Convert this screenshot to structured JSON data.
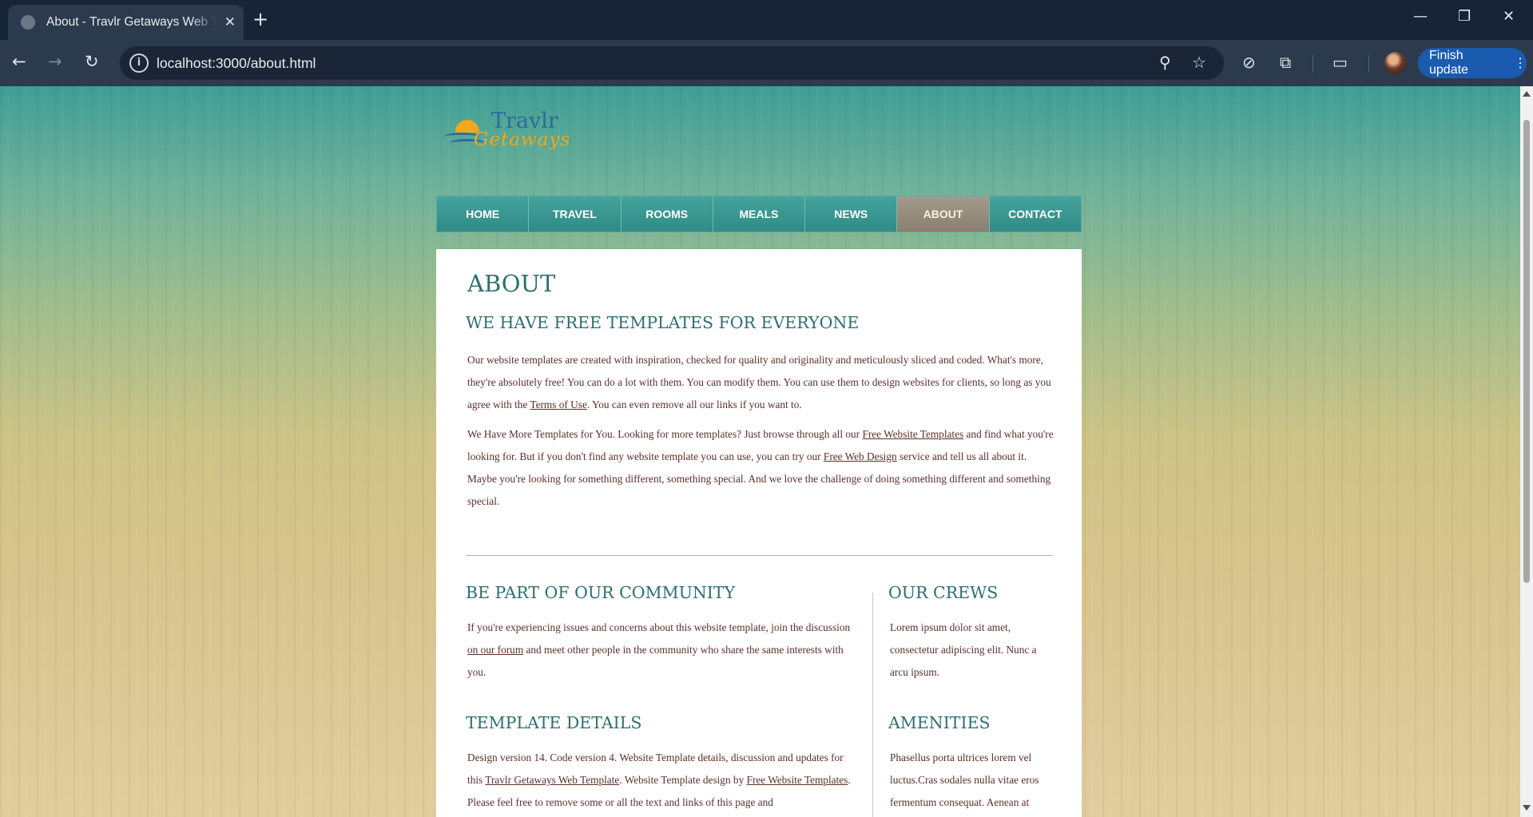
{
  "browser": {
    "tab_title": "About - Travlr Getaways Web Template",
    "tab_close": "✕",
    "new_tab": "+",
    "url": "localhost:3000/about.html",
    "update_button": "Finish update",
    "update_menu": "⋮"
  },
  "site": {
    "logo": {
      "word1": "Travlr",
      "word2": "Getaways"
    },
    "nav": [
      "Home",
      "Travel",
      "Rooms",
      "Meals",
      "News",
      "About",
      "Contact"
    ],
    "active_nav": "About",
    "page_title": "ABOUT",
    "intro_heading": "We Have Free Templates for Everyone",
    "intro_p1": {
      "t1": "Our website templates are created with inspiration, checked for quality and originality and meticulously sliced and coded. What's more, they're absolutely free! You can do a lot with them. You can modify them. You can use them to design websites for clients, so long as you agree with the ",
      "link1": "Terms of Use",
      "t2": ". You can even remove all our links if you want to."
    },
    "intro_p2": {
      "t1": "We Have More Templates for You. Looking for more templates? Just browse through all our ",
      "link1": "Free Website Templates",
      "t2": " and find what you're looking for. But if you don't find any website template you can use, you can try our ",
      "link2": "Free Web Design",
      "t3": " service and tell us all about it. Maybe you're looking for something different, something special. And we love the challenge of doing something different and something special."
    },
    "community": {
      "heading": "Be Part of Our Community",
      "t1": "If you're experiencing issues and concerns about this website template, join the discussion ",
      "link1": "on our forum",
      "t2": " and meet other people in the community who share the same interests with you."
    },
    "template_details": {
      "heading": "Template Details",
      "t1": "Design version 14. Code version 4. Website Template details, discussion and updates for this ",
      "link1": "Travlr Getaways Web Template",
      "t2": ". Website Template design by ",
      "link2": "Free Website Templates",
      "t3": ". Please feel free to remove some or all the text and links of this page and"
    },
    "crews": {
      "heading": "Our Crews",
      "text": "Lorem ipsum dolor sit amet, consectetur adipiscing elit. Nunc a arcu ipsum."
    },
    "amenities": {
      "heading": "Amenities",
      "text": "Phasellus porta ultrices lorem vel luctus.Cras sodales nulla vitae eros fermentum consequat. Aenean at"
    }
  }
}
